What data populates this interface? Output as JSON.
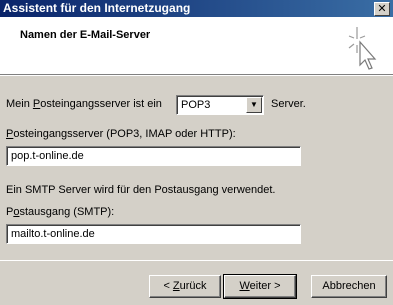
{
  "window": {
    "title": "Assistent für den Internetzugang",
    "close_glyph": "✕"
  },
  "header": {
    "title": "Namen der E-Mail-Server",
    "icon": "wizard-sparkle-cursor-icon"
  },
  "form": {
    "incoming_type_prefix_u": "P",
    "incoming_type_prefix_pre": "Mein ",
    "incoming_type_prefix_post": "osteingangsserver ist ein",
    "incoming_type_value": "POP3",
    "incoming_type_suffix": "Server.",
    "incoming_server_label_u": "P",
    "incoming_server_label_post": "osteingangsserver (POP3, IMAP oder HTTP):",
    "incoming_server_value": "pop.t-online.de",
    "smtp_info": "Ein SMTP Server wird für den Postausgang verwendet.",
    "outgoing_label_pre": "P",
    "outgoing_label_u": "o",
    "outgoing_label_post": "stausgang (SMTP):",
    "outgoing_value": "mailto.t-online.de"
  },
  "buttons": {
    "back_pre": "< ",
    "back_u": "Z",
    "back_post": "urück",
    "next_u": "W",
    "next_post": "eiter >",
    "cancel": "Abbrechen"
  }
}
